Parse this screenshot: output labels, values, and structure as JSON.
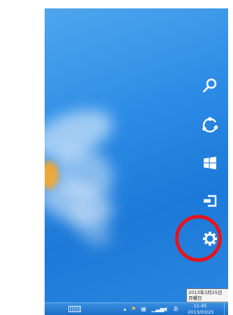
{
  "charms": [
    {
      "name": "search",
      "icon": "search-icon"
    },
    {
      "name": "share",
      "icon": "share-icon"
    },
    {
      "name": "start",
      "icon": "windows-logo-icon"
    },
    {
      "name": "devices",
      "icon": "devices-icon"
    },
    {
      "name": "settings",
      "icon": "gear-icon"
    }
  ],
  "tooltip": {
    "date_line": "2013年3月25日",
    "weekday_line": "月曜日"
  },
  "taskbar": {
    "time": "11:45",
    "date": "2013/03/25"
  },
  "colors": {
    "highlight": "#e8131b",
    "charm_icon": "#ffffff"
  }
}
